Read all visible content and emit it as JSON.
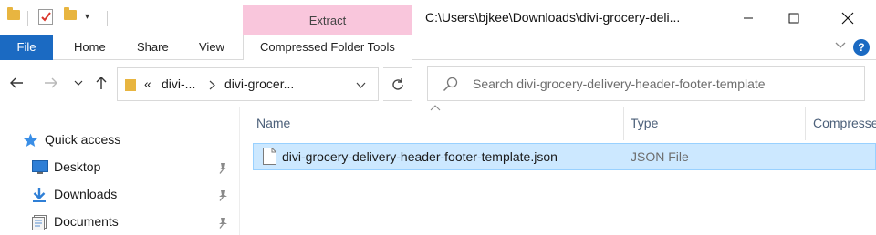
{
  "window": {
    "title": "C:\\Users\\bjkee\\Downloads\\divi-grocery-deli...",
    "context_tab_group": "Extract"
  },
  "ribbon": {
    "tabs": [
      {
        "label": "File"
      },
      {
        "label": "Home"
      },
      {
        "label": "Share"
      },
      {
        "label": "View"
      },
      {
        "label": "Compressed Folder Tools"
      }
    ],
    "help": "?"
  },
  "address": {
    "overflow": "«",
    "crumbs": [
      "divi-...",
      "divi-grocer..."
    ]
  },
  "search": {
    "placeholder": "Search divi-grocery-delivery-header-footer-template"
  },
  "navpane": {
    "items": [
      {
        "label": "Quick access",
        "icon": "star-icon"
      },
      {
        "label": "Desktop",
        "icon": "desktop-icon",
        "pinned": true
      },
      {
        "label": "Downloads",
        "icon": "download-arrow-icon",
        "pinned": true
      },
      {
        "label": "Documents",
        "icon": "documents-icon",
        "pinned": true
      }
    ]
  },
  "filelist": {
    "columns": [
      "Name",
      "Type",
      "Compresse"
    ],
    "rows": [
      {
        "name": "divi-grocery-delivery-header-footer-template.json",
        "type": "JSON File"
      }
    ]
  },
  "colors": {
    "accent": "#1b6ac2",
    "context_tab": "#f9c6dc",
    "selection": "#cce8ff",
    "folder": "#e8b540"
  }
}
